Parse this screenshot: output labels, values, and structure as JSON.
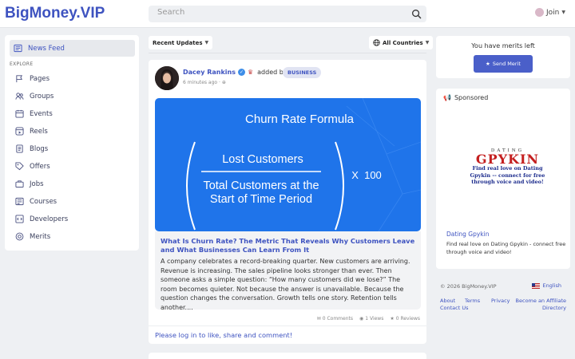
{
  "header": {
    "logo": "BigMoney.VIP",
    "search_placeholder": "Search",
    "join_label": "Join"
  },
  "sidebar": {
    "feed_label": "News Feed",
    "section_label": "EXPLORE",
    "items": [
      {
        "label": "Pages",
        "icon": "flag-icon"
      },
      {
        "label": "Groups",
        "icon": "groups-icon"
      },
      {
        "label": "Events",
        "icon": "calendar-icon"
      },
      {
        "label": "Reels",
        "icon": "reels-icon"
      },
      {
        "label": "Blogs",
        "icon": "blog-icon"
      },
      {
        "label": "Offers",
        "icon": "tag-icon"
      },
      {
        "label": "Jobs",
        "icon": "briefcase-icon"
      },
      {
        "label": "Courses",
        "icon": "course-icon"
      },
      {
        "label": "Developers",
        "icon": "code-icon"
      },
      {
        "label": "Merits",
        "icon": "merit-icon"
      }
    ]
  },
  "feed": {
    "sort_label": "Recent Updates",
    "country_label": "All Countries"
  },
  "post": {
    "author": "Dacey Rankins",
    "action": "added blog",
    "badge": "BUSINESS",
    "time": "6 minutes ago",
    "image": {
      "title": "Churn Rate Formula",
      "numerator": "Lost Customers",
      "denominator_line1": "Total Customers at the",
      "denominator_line2": "Start of Time Period",
      "multiplier": "X  100"
    },
    "title": "What Is Churn Rate? The Metric That Reveals Why Customers Leave and What Businesses Can Learn From It",
    "excerpt": "A company celebrates a record-breaking quarter. New customers are arriving. Revenue is increasing. The sales pipeline looks stronger than ever. Then someone asks a simple question: “How many customers did we lose?” The room becomes quieter. Not because the answer is unavailable. Because the question changes the conversation. Growth tells one story. Retention tells another....",
    "comments": "0 Comments",
    "views": "1 Views",
    "reviews": "0 Reviews",
    "login_prompt": "Please log in to like, share and comment!"
  },
  "merits": {
    "text": "You have merits left",
    "button": "Send Merit"
  },
  "sponsored": {
    "heading": "Sponsored",
    "brand_top": "DATING",
    "brand": "GPYKIN",
    "tagline": "Find real love on Dating Gpykin -- connect for free through voice and video!",
    "name": "Dating Gpykin",
    "description": "Find real love on Dating Gpykin - connect free through voice and video!"
  },
  "footer": {
    "copyright": "© 2026 BigMoney.VIP",
    "language": "English",
    "links": [
      "About",
      "Terms",
      "Privacy",
      "Become an Affiliate",
      "Contact Us",
      "Directory"
    ]
  },
  "colors": {
    "accent": "#3e53c0",
    "hero_blue": "#1f74ea",
    "brand_red": "#c41f1f"
  }
}
